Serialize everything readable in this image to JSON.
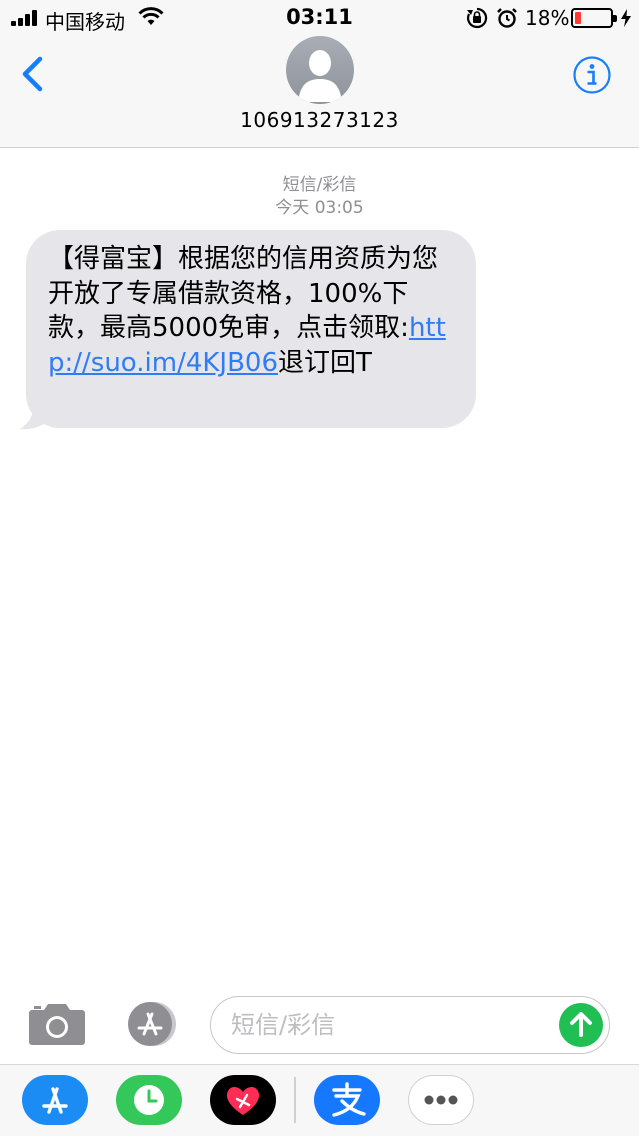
{
  "status_bar": {
    "carrier": "中国移动",
    "time": "03:11",
    "battery_percent_label": "18%",
    "battery_level": 0.18,
    "battery_color": "#ff3b30",
    "icons": [
      "signal-icon",
      "wifi-icon",
      "rotation-lock-icon",
      "alarm-icon",
      "battery-icon",
      "charging-bolt-icon"
    ]
  },
  "header": {
    "back_icon": "chevron-left-icon",
    "contact_name": "106913273123",
    "info_icon": "info-icon",
    "accent_color": "#147efb"
  },
  "conversation": {
    "message_kind": "短信/彩信",
    "timestamp": "今天 03:05",
    "messages": [
      {
        "direction": "incoming",
        "text_before_link": "【得富宝】根据您的信用资质为您开放了专属借款资格，100%下款，最高5000免审，点击领取:",
        "link": "http://suo.im/4KJB06",
        "text_after_link": "退订回T"
      }
    ],
    "bubble_color": "#e5e5ea"
  },
  "input_bar": {
    "placeholder": "短信/彩信",
    "camera_icon": "camera-icon",
    "app_store_icon": "app-store-icon",
    "send_icon": "send-arrow-up-icon",
    "send_color": "#1fbf53"
  },
  "app_drawer": {
    "apps": [
      {
        "name": "app-store-app",
        "color": "#1c8cf5"
      },
      {
        "name": "clock-app",
        "color": "#34c759"
      },
      {
        "name": "digital-touch-app",
        "color": "#000000"
      },
      {
        "name": "alipay-app",
        "color": "#1677ff"
      },
      {
        "name": "more-apps",
        "color": "#ffffff"
      }
    ]
  }
}
